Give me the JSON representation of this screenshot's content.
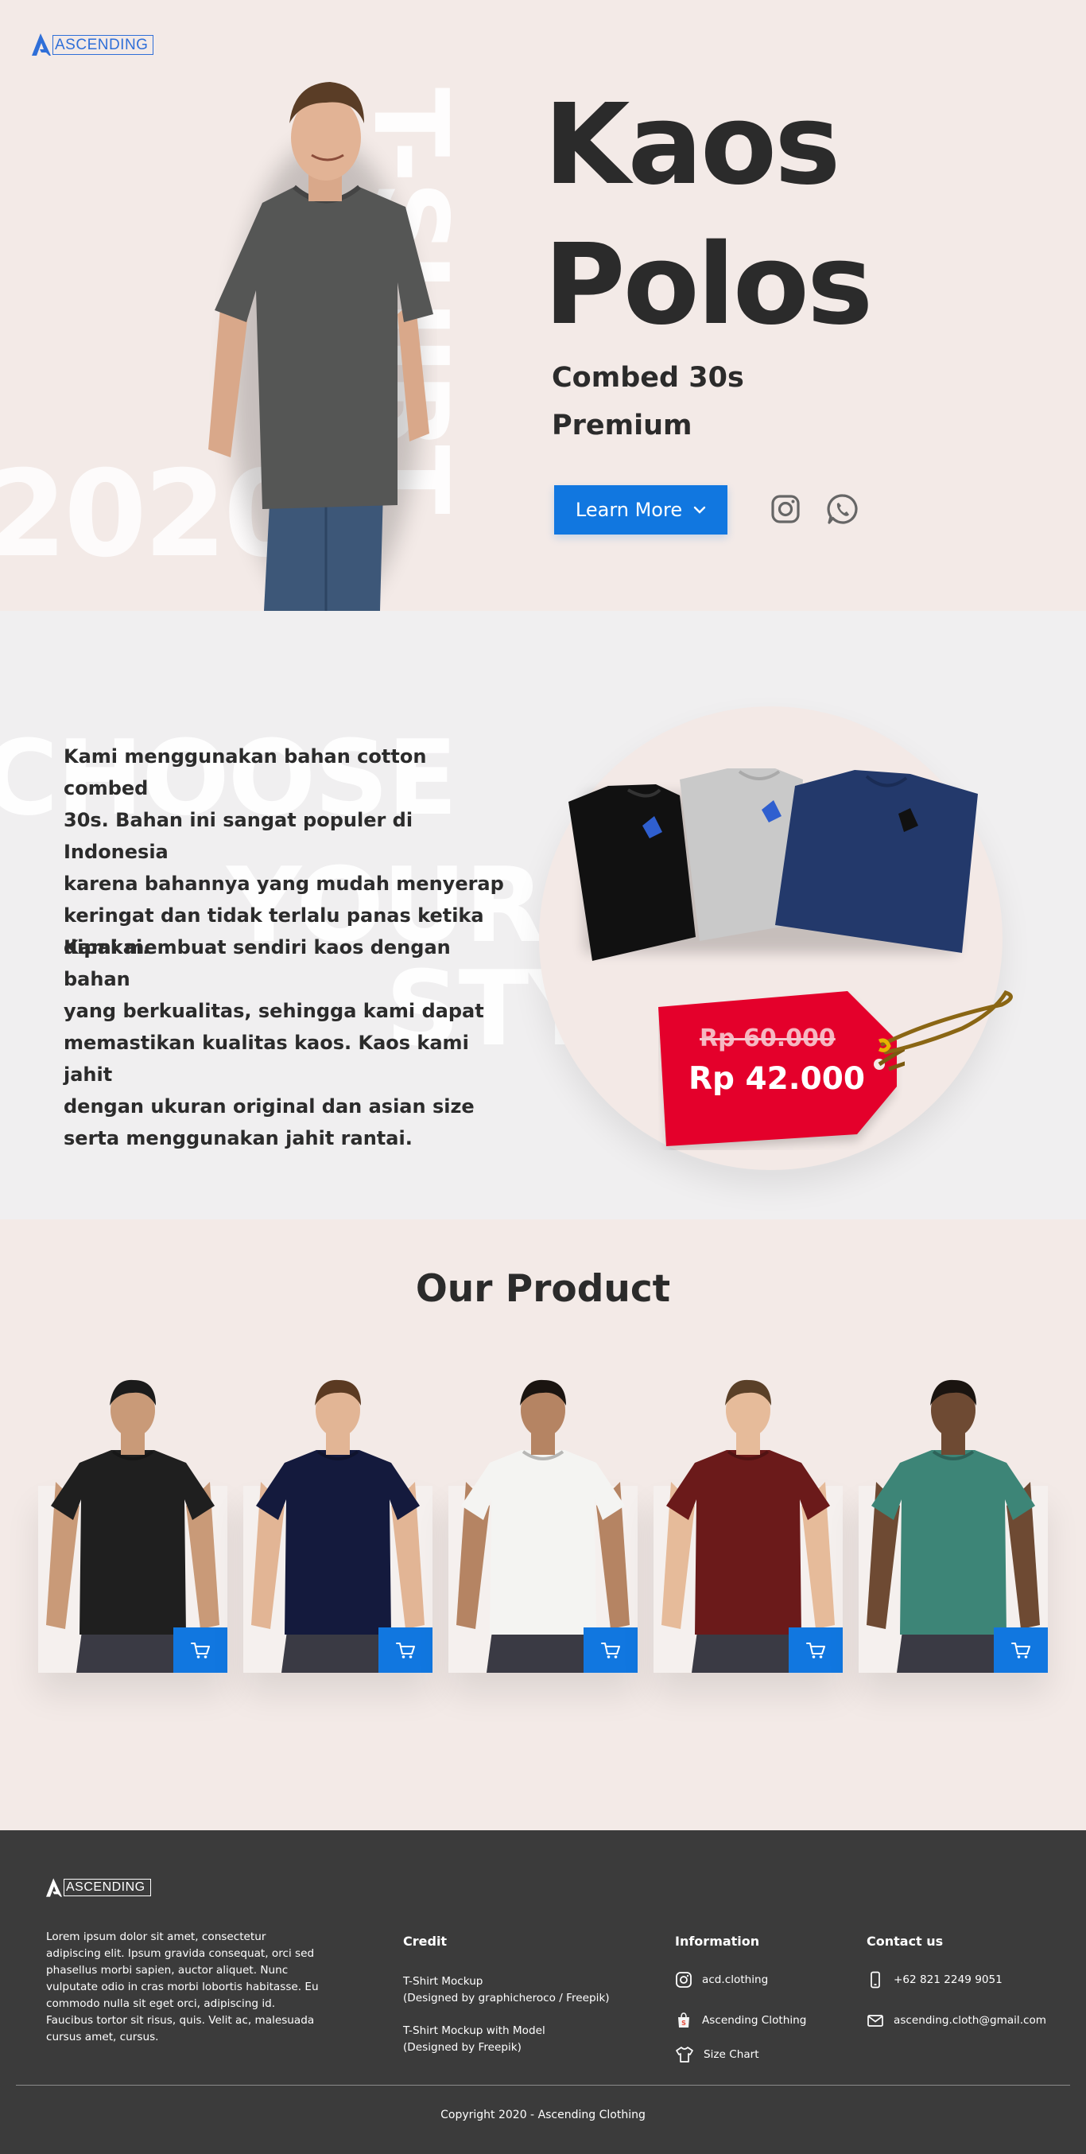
{
  "brand": {
    "name": "ASCENDING",
    "accent": "#1177e0",
    "logo_color": "#2f6fd8"
  },
  "hero": {
    "bg_year": "2020",
    "bg_vertical": "T-SHIRT",
    "title_line1": "Kaos",
    "title_line2": "Polos",
    "subtitle_line1": "Combed 30s",
    "subtitle_line2": "Premium",
    "cta_label": "Learn More",
    "social_icons": [
      "instagram-icon",
      "whatsapp-icon"
    ]
  },
  "about": {
    "bg_words": [
      "CHOOSE",
      "YOUR",
      "STY"
    ],
    "paragraph1": [
      "Kami menggunakan bahan cotton combed",
      "30s. Bahan ini sangat populer di Indonesia",
      "karena bahannya yang mudah menyerap",
      "keringat dan tidak terlalu panas ketika",
      "dipakai."
    ],
    "paragraph2": [
      "Kami membuat sendiri kaos dengan bahan",
      "yang berkualitas, sehingga kami dapat",
      "memastikan kualitas kaos. Kaos kami jahit",
      "dengan ukuran original dan asian size",
      "serta menggunakan jahit rantai."
    ],
    "price_old": "Rp 60.000",
    "price_new": "Rp 42.000",
    "tag_color": "#e4002b",
    "shirt_colors": [
      "#111111",
      "#c8c8c8",
      "#23396b"
    ]
  },
  "products": {
    "title": "Our Product",
    "items": [
      {
        "shirt_color": "#1f1f1f",
        "skin": "#c99a78",
        "hair": "#1b1b1b",
        "cart_icon": "cart-icon"
      },
      {
        "shirt_color": "#141a3d",
        "skin": "#e2b595",
        "hair": "#5b3a22",
        "cart_icon": "cart-icon"
      },
      {
        "shirt_color": "#f4f4f2",
        "skin": "#b58463",
        "hair": "#1a1410",
        "cart_icon": "cart-icon"
      },
      {
        "shirt_color": "#6b1a1a",
        "skin": "#e6bb9a",
        "hair": "#5a4028",
        "cart_icon": "cart-icon"
      },
      {
        "shirt_color": "#3d8577",
        "skin": "#6e4a33",
        "hair": "#1a1410",
        "cart_icon": "cart-icon"
      }
    ]
  },
  "footer": {
    "about": [
      "Lorem ipsum dolor sit amet, consectetur",
      "adipiscing elit. Ipsum gravida consequat, orci sed",
      "phasellus morbi sapien, auctor aliquet. Nunc",
      "vulputate odio in cras morbi lobortis habitasse. Eu",
      "commodo nulla sit eget orci, adipiscing id.",
      "Faucibus tortor sit risus, quis. Velit ac, malesuada",
      "cursus amet, cursus."
    ],
    "credit_title": "Credit",
    "credit1_line1": "T-Shirt Mockup",
    "credit1_line2": "(Designed by graphicheroco / Freepik)",
    "credit2_line1": "T-Shirt Mockup with Model",
    "credit2_line2": "(Designed by Freepik)",
    "info_title": "Information",
    "info_instagram": "acd.clothing",
    "info_shop": "Ascending Clothing",
    "info_size": "Size Chart",
    "contact_title": "Contact us",
    "contact_phone": "+62 821 2249 9051",
    "contact_email": "ascending.cloth@gmail.com",
    "copyright": "Copyright 2020 - Ascending Clothing"
  }
}
